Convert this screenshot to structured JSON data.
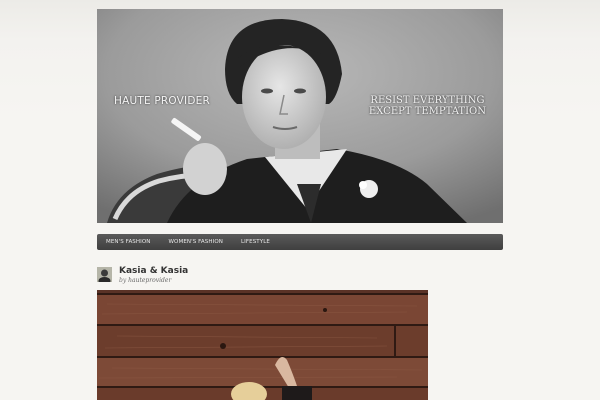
{
  "header": {
    "site_title": "HAUTE PROVIDER",
    "tagline_line1": "RESIST EVERYTHING",
    "tagline_line2": "EXCEPT TEMPTATION"
  },
  "nav": {
    "items": [
      {
        "label": "Men's Fashion"
      },
      {
        "label": "Women's Fashion"
      },
      {
        "label": "Lifestyle"
      }
    ]
  },
  "post": {
    "title": "Kasia & Kasia",
    "byline_prefix": "by",
    "author": "hauteprovider"
  },
  "colors": {
    "nav_bg": "#4a4a4a",
    "page_bg": "#f6f5f2",
    "wood": "#6e3f2c"
  }
}
